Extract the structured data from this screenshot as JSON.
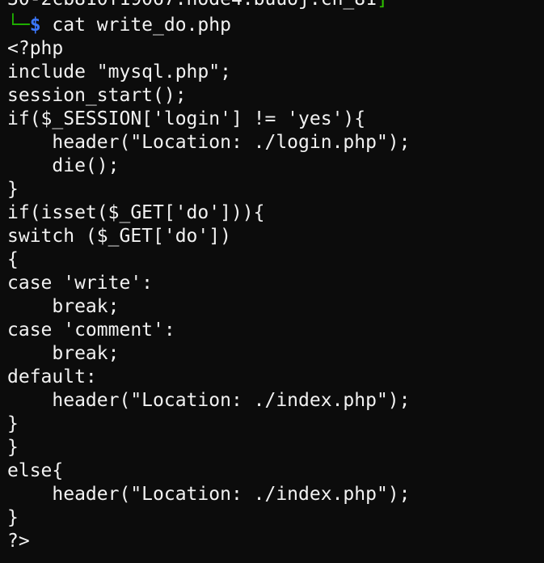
{
  "terminal": {
    "partial_host_line": "30-2cb810f19067.node4.buuoj.cn_81",
    "partial_host_bracket": "]",
    "prompt_prefix": "└─",
    "prompt_symbol": "$",
    "command": " cat write_do.php",
    "code_lines": [
      "<?php",
      "include \"mysql.php\";",
      "session_start();",
      "if($_SESSION['login'] != 'yes'){",
      "    header(\"Location: ./login.php\");",
      "    die();",
      "}",
      "if(isset($_GET['do'])){",
      "switch ($_GET['do'])",
      "{",
      "case 'write':",
      "    break;",
      "case 'comment':",
      "    break;",
      "default:",
      "    header(\"Location: ./index.php\");",
      "}",
      "}",
      "else{",
      "    header(\"Location: ./index.php\");",
      "}",
      "?>"
    ]
  },
  "colors": {
    "background": "#0c0c0c",
    "text": "#f2f2f2",
    "prompt_tree": "#1fb300",
    "prompt_symbol": "#3b78ff"
  }
}
